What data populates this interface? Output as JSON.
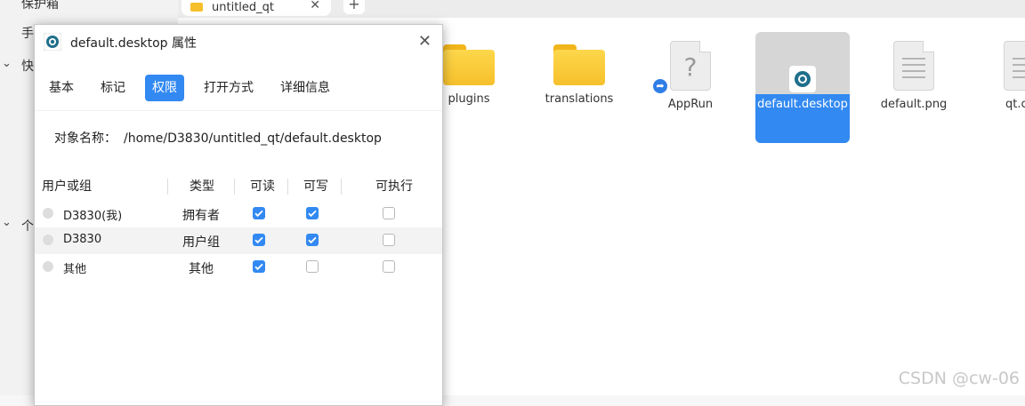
{
  "sidebar": {
    "items": [
      "保护箱",
      "手",
      "快",
      "个"
    ]
  },
  "tabbar": {
    "tab_label": "untitled_qt",
    "close_glyph": "✕",
    "newtab_glyph": "+"
  },
  "files": [
    {
      "name": "plugins",
      "icon": "folder-icon"
    },
    {
      "name": "translations",
      "icon": "folder-icon"
    },
    {
      "name": "AppRun",
      "icon": "unknown-file-icon"
    },
    {
      "name": "default.desktop",
      "icon": "desktop-entry-icon",
      "selected": true
    },
    {
      "name": "default.png",
      "icon": "document-icon"
    },
    {
      "name": "qt.c",
      "icon": "document-icon"
    }
  ],
  "watermark": "CSDN @cw-06",
  "dialog": {
    "title": "default.desktop 属性",
    "close_glyph": "✕",
    "tabs": [
      "基本",
      "标记",
      "权限",
      "打开方式",
      "详细信息"
    ],
    "active_tab": "权限",
    "object_label": "对象名称：",
    "object_path": "/home/D3830/untitled_qt/default.desktop",
    "columns": [
      "用户或组",
      "类型",
      "可读",
      "可写",
      "可执行"
    ],
    "rows": [
      {
        "user": "D3830(我)",
        "type": "拥有者",
        "read": true,
        "write": true,
        "exec": false
      },
      {
        "user": "D3830",
        "type": "用户组",
        "read": true,
        "write": true,
        "exec": false
      },
      {
        "user": "其他",
        "type": "其他",
        "read": true,
        "write": false,
        "exec": false
      }
    ]
  },
  "colors": {
    "accent": "#3289f1",
    "folder": "#f6c02c"
  }
}
